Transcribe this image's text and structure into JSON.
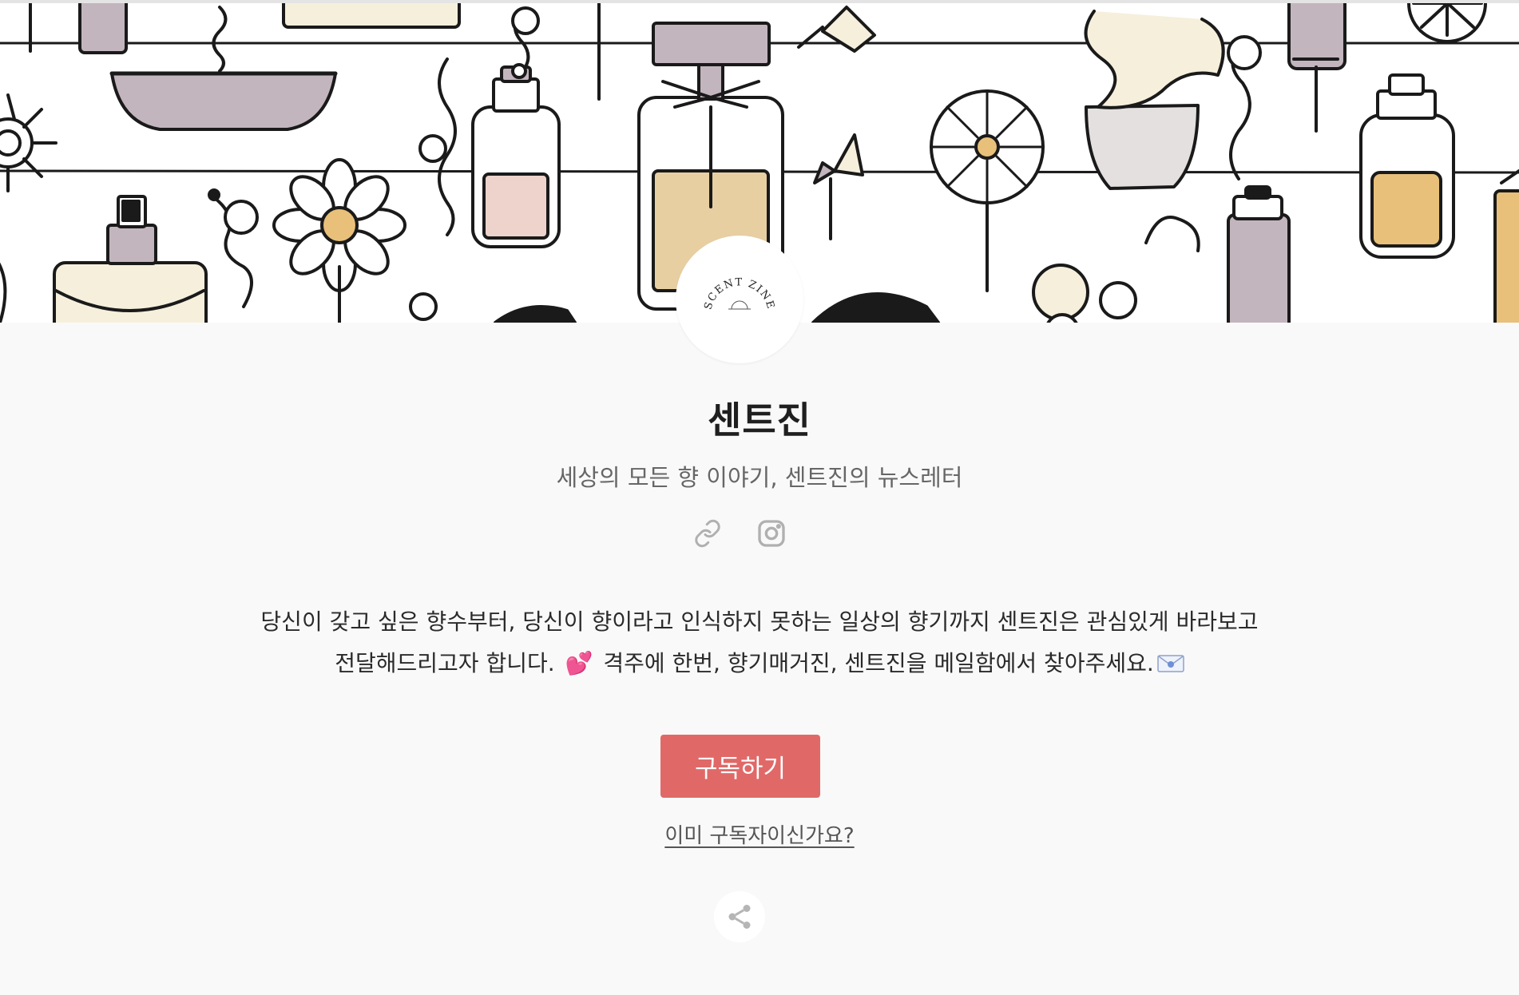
{
  "header": {
    "logo_text": "SCENT ZINE"
  },
  "profile": {
    "name": "센트진",
    "tagline": "세상의 모든 향 이야기, 센트진의 뉴스레터"
  },
  "social": {
    "icons": [
      "link-icon",
      "instagram-icon"
    ]
  },
  "description": {
    "line1": "당신이 갖고 싶은 향수부터, 당신이 향이라고 인식하지 못하는 일상의 향기까지 센트진은 관심있게 바라보고",
    "line2_before": "전달해드리고자 합니다.",
    "heart_emoji": "💕",
    "line2_after": "격주에 한번, 향기매거진, 센트진을 메일함에서 찾아주세요.",
    "mail_icon": "envelope-heart-icon"
  },
  "actions": {
    "subscribe_label": "구독하기",
    "already_subscriber_label": "이미 구독자이신가요?",
    "share_icon": "share-icon"
  },
  "colors": {
    "accent": "#e06968",
    "background": "#f9f9f9",
    "banner_mauve": "#c2b5bd",
    "banner_tan": "#e8cfa2",
    "banner_pink": "#eed3cc",
    "banner_cream": "#f5efdc",
    "banner_gold": "#e8c07a"
  }
}
